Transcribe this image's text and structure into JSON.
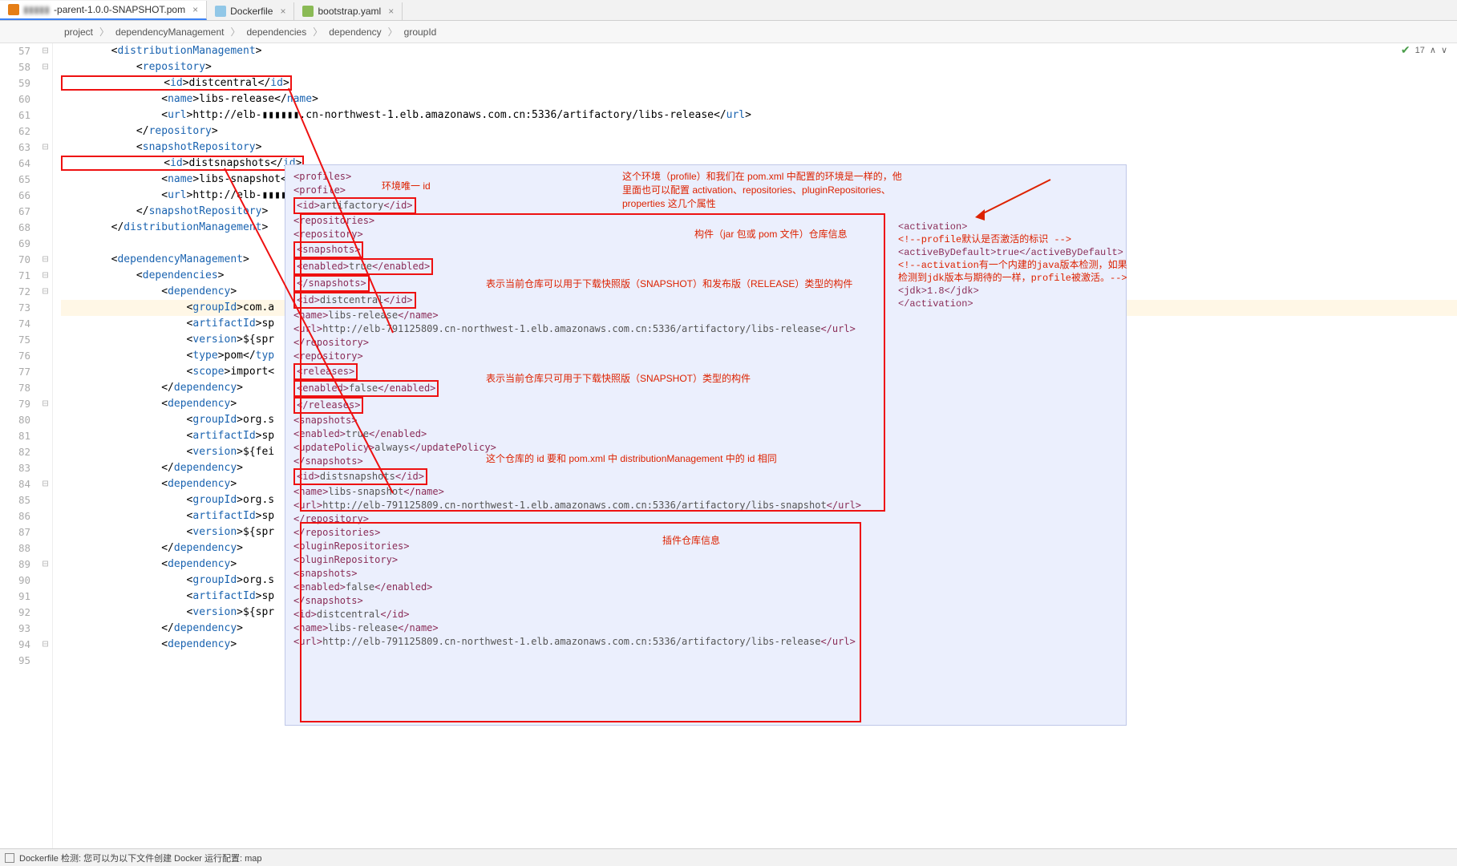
{
  "tabs": {
    "t0": {
      "label": "-parent-1.0.0-SNAPSHOT.pom"
    },
    "t1": {
      "label": "Dockerfile"
    },
    "t2": {
      "label": "bootstrap.yaml"
    },
    "close": "×"
  },
  "breadcrumb": {
    "b0": "project",
    "b1": "dependencyManagement",
    "b2": "dependencies",
    "b3": "dependency",
    "b4": "groupId",
    "sep": "〉"
  },
  "gutter": {
    "start": 57,
    "end": 95
  },
  "status_tr": {
    "checks": "17",
    "prev": "∧",
    "next": "∨"
  },
  "code": {
    "l57": {
      "pre": "        <",
      "t1": "distributionManagement",
      "post": ">"
    },
    "l58": {
      "pre": "            <",
      "t1": "repository",
      "post": ">"
    },
    "l59": {
      "pre": "                <",
      "t1": "id",
      "mid": ">distcentral</",
      "t2": "id",
      "post": ">"
    },
    "l60": {
      "pre": "                <",
      "t1": "name",
      "mid": ">libs-release</",
      "t2": "name",
      "post": ">"
    },
    "l61": {
      "pre": "                <",
      "t1": "url",
      "mid": ">http://elb-▮▮▮▮▮▮.cn-northwest-1.elb.amazonaws.com.cn:5336/artifactory/libs-release</",
      "t2": "url",
      "post": ">"
    },
    "l62": {
      "pre": "            </",
      "t1": "repository",
      "post": ">"
    },
    "l63": {
      "pre": "            <",
      "t1": "snapshotRepository",
      "post": ">"
    },
    "l64": {
      "pre": "                <",
      "t1": "id",
      "mid": ">distsnapshots</",
      "t2": "id",
      "post": ">"
    },
    "l65": {
      "pre": "                <",
      "t1": "name",
      "mid": ">libs-snapshot</",
      "t2": "name",
      "post": ">"
    },
    "l66": {
      "pre": "                <",
      "t1": "url",
      "mid": ">http://elb-▮▮▮▮▮▮.cn-northwest-1.elb.amazonaws.com.cn:5336/artifactory/libs-snapshot</",
      "t2": "url",
      "post": ">"
    },
    "l67": {
      "pre": "            </",
      "t1": "snapshotRepository",
      "post": ">"
    },
    "l68": {
      "pre": "        </",
      "t1": "distributionManagement",
      "post": ">"
    },
    "l69": {
      "pre": " "
    },
    "l70": {
      "pre": "        <",
      "t1": "dependencyManagement",
      "post": ">"
    },
    "l71": {
      "pre": "            <",
      "t1": "dependencies",
      "post": ">"
    },
    "l72": {
      "pre": "                <",
      "t1": "dependency",
      "post": ">"
    },
    "l73": {
      "pre": "                    <",
      "t1": "groupId",
      "mid": ">com.a"
    },
    "l74": {
      "pre": "                    <",
      "t1": "artifactId",
      "mid": ">sp"
    },
    "l75": {
      "pre": "                    <",
      "t1": "version",
      "mid": ">${spr"
    },
    "l76": {
      "pre": "                    <",
      "t1": "type",
      "mid": ">pom</",
      "t2": "typ"
    },
    "l77": {
      "pre": "                    <",
      "t1": "scope",
      "mid": ">import<"
    },
    "l78": {
      "pre": "                </",
      "t1": "dependency",
      "post": ">"
    },
    "l79": {
      "pre": "                <",
      "t1": "dependency",
      "post": ">"
    },
    "l80": {
      "pre": "                    <",
      "t1": "groupId",
      "mid": ">org.s"
    },
    "l81": {
      "pre": "                    <",
      "t1": "artifactId",
      "mid": ">sp"
    },
    "l82": {
      "pre": "                    <",
      "t1": "version",
      "mid": ">${fei"
    },
    "l83": {
      "pre": "                </",
      "t1": "dependency",
      "post": ">"
    },
    "l84": {
      "pre": "                <",
      "t1": "dependency",
      "post": ">"
    },
    "l85": {
      "pre": "                    <",
      "t1": "groupId",
      "mid": ">org.s"
    },
    "l86": {
      "pre": "                    <",
      "t1": "artifactId",
      "mid": ">sp"
    },
    "l87": {
      "pre": "                    <",
      "t1": "version",
      "mid": ">${spr"
    },
    "l88": {
      "pre": "                </",
      "t1": "dependency",
      "post": ">"
    },
    "l89": {
      "pre": "                <",
      "t1": "dependency",
      "post": ">"
    },
    "l90": {
      "pre": "                    <",
      "t1": "groupId",
      "mid": ">org.s"
    },
    "l91": {
      "pre": "                    <",
      "t1": "artifactId",
      "mid": ">sp"
    },
    "l92": {
      "pre": "                    <",
      "t1": "version",
      "mid": ">${spr"
    },
    "l93": {
      "pre": "                </",
      "t1": "dependency",
      "post": ">"
    },
    "l94": {
      "pre": "                <",
      "t1": "dependency",
      "post": ">"
    },
    "l95": {
      "pre": " "
    }
  },
  "overlay": {
    "annot_top": "这个环境（profile）和我们在 pom.xml 中配置的环境是一样的，他里面也可以配置 activation、repositories、pluginRepositories、properties 这几个属性",
    "annot_id": "环境唯一 id",
    "annot_repo": "构件（jar 包或 pom 文件）仓库信息",
    "annot_snaprel": "表示当前仓库可以用于下载快照版（SNAPSHOT）和发布版（RELEASE）类型的构件",
    "annot_snaponly": "表示当前仓库只可用于下载快照版（SNAPSHOT）类型的构件",
    "annot_idmatch": "这个仓库的 id 要和 pom.xml 中 distributionManagement 中的 id 相同",
    "annot_plugin": "插件仓库信息",
    "lines": {
      "p0": "<profiles>",
      "p1": "  <profile>",
      "p2": "    <id>artifactory</id>",
      "p3": "    <repositories>",
      "p4": "      <repository>",
      "p5": "        <snapshots>",
      "p6": "          <enabled>true</enabled>",
      "p7": "        </snapshots>",
      "p8": "        <id>distcentral</id>",
      "p9": "        <name>libs-release</name>",
      "p10": "        <url>http://elb-791125809.cn-northwest-1.elb.amazonaws.com.cn:5336/artifactory/libs-release</url>",
      "p11": "      </repository>",
      "p12": "      <repository>",
      "p13": "        <releases>",
      "p14": "          <enabled>false</enabled>",
      "p15": "        </releases>",
      "p16": "        <snapshots>",
      "p17": "          <enabled>true</enabled>",
      "p18": "          <updatePolicy>always</updatePolicy>",
      "p19": "        </snapshots>",
      "p20": "        <id>distsnapshots</id>",
      "p21": "        <name>libs-snapshot</name>",
      "p22": "        <url>http://elb-791125809.cn-northwest-1.elb.amazonaws.com.cn:5336/artifactory/libs-snapshot</url>",
      "p23": "      </repository>",
      "p24": "    </repositories>",
      "p25": "    <pluginRepositories>",
      "p26": "      <pluginRepository>",
      "p27": "        <snapshots>",
      "p28": "          <enabled>false</enabled>",
      "p29": "        </snapshots>",
      "p30": "        <id>distcentral</id>",
      "p31": "        <name>libs-release</name>",
      "p32": "        <url>http://elb-791125809.cn-northwest-1.elb.amazonaws.com.cn:5336/artifactory/libs-release</url>"
    }
  },
  "side": {
    "s0": "<activation>",
    "s1": "  <!--profile默认是否激活的标识 -->",
    "s2": "  <activeByDefault>true</activeByDefault>",
    "s3": "  <!--activation有一个内建的java版本检测，如果",
    "s4": "  检测到jdk版本与期待的一样，profile被激活。-->",
    "s5": "  <jdk>1.8</jdk>",
    "s6": "</activation>"
  },
  "status": {
    "msg": "Dockerfile 检测: 您可以为以下文件创建 Docker 运行配置: map"
  }
}
